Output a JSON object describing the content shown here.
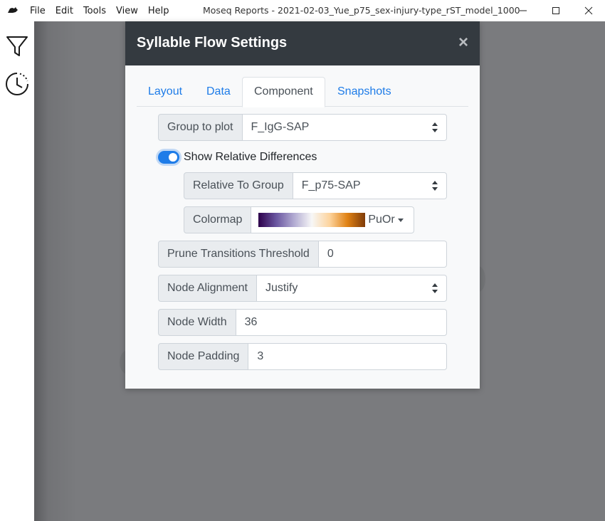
{
  "window": {
    "title": "Moseq Reports - 2021-02-03_Yue_p75_sex-injury-type_rST_model_1000",
    "menu": [
      "File",
      "Edit",
      "Tools",
      "View",
      "Help"
    ]
  },
  "sidebar": {
    "icons": [
      "filter-icon",
      "history-icon"
    ]
  },
  "modal": {
    "title": "Syllable Flow Settings",
    "close_label": "×",
    "tabs": [
      {
        "label": "Layout",
        "active": false
      },
      {
        "label": "Data",
        "active": false
      },
      {
        "label": "Component",
        "active": true
      },
      {
        "label": "Snapshots",
        "active": false
      }
    ],
    "group_to_plot": {
      "label": "Group to plot",
      "value": "F_IgG-SAP"
    },
    "show_relative_differences": {
      "label": "Show Relative Differences",
      "enabled": true
    },
    "relative_to_group": {
      "label": "Relative To Group",
      "value": "F_p75-SAP"
    },
    "colormap": {
      "label": "Colormap",
      "value": "PuOr"
    },
    "prune_threshold": {
      "label": "Prune Transitions Threshold",
      "value": "0"
    },
    "node_alignment": {
      "label": "Node Alignment",
      "value": "Justify"
    },
    "node_width": {
      "label": "Node Width",
      "value": "36"
    },
    "node_padding": {
      "label": "Node Padding",
      "value": "3"
    }
  },
  "colors": {
    "header_bg": "#343a40",
    "accent": "#1e7ce8",
    "backdrop": "#7a7b7e"
  }
}
